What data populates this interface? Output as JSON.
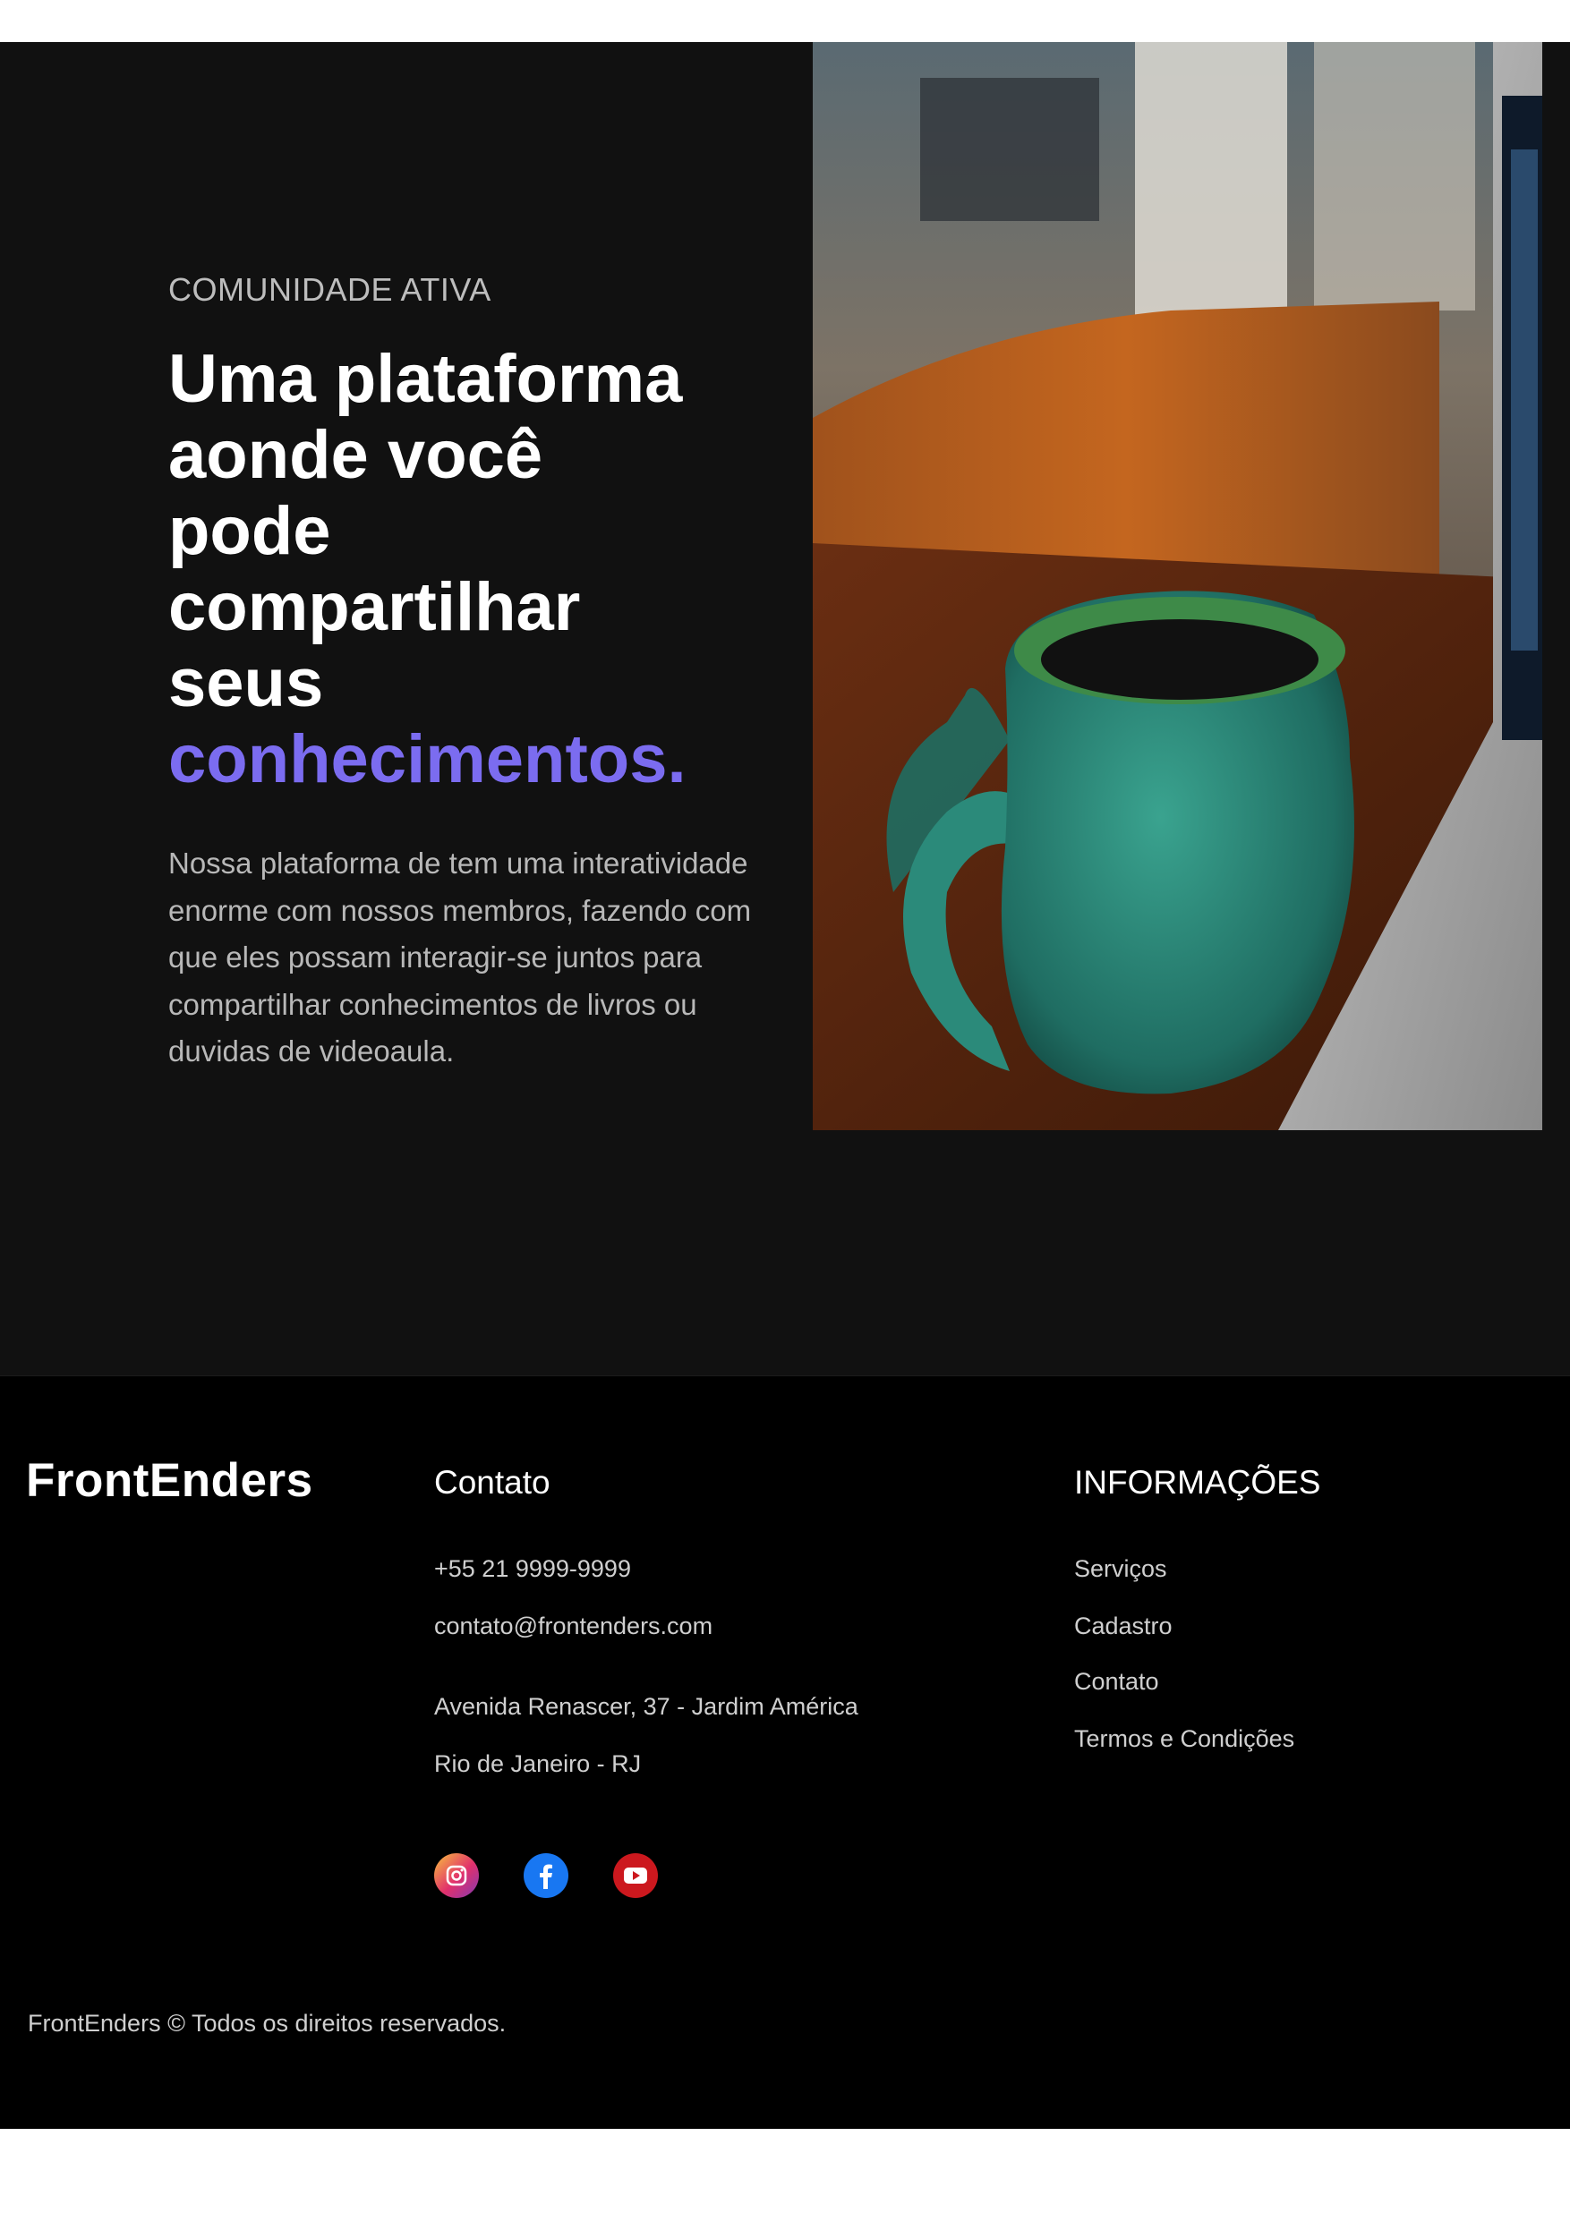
{
  "hero": {
    "eyebrow": "COMUNIDADE ATIVA",
    "headline_lines": [
      "Uma plataforma",
      "aonde você",
      "pode",
      "compartilhar",
      "seus"
    ],
    "headline_accent": "conhecimentos.",
    "lead": "Nossa plataforma de tem uma interatividade enorme com nossos membros, fazendo com que eles possam interagir-se juntos para compartilhar conhecimentos de livros ou duvidas de videoaula.",
    "accent_color": "#7b6cf0",
    "image": "green ceramic mug on wooden table beside laptop"
  },
  "footer": {
    "brand": "FrontEnders",
    "contact": {
      "title": "Contato",
      "phone": "+55 21 9999-9999",
      "email": "contato@frontenders.com",
      "address_line1": "Avenida Renascer, 37 - Jardim América",
      "address_line2": "Rio de Janeiro - RJ"
    },
    "info": {
      "title": "INFORMAÇÕES",
      "links": [
        "Serviços",
        "Cadastro",
        "Contato",
        "Termos e Condições"
      ]
    },
    "social": [
      {
        "icon": "instagram-icon",
        "color": "#e1306c"
      },
      {
        "icon": "facebook-icon",
        "color": "#1877f2"
      },
      {
        "icon": "youtube-icon",
        "color": "#cc181e"
      }
    ],
    "copyright": "FrontEnders © Todos os direitos reservados."
  }
}
